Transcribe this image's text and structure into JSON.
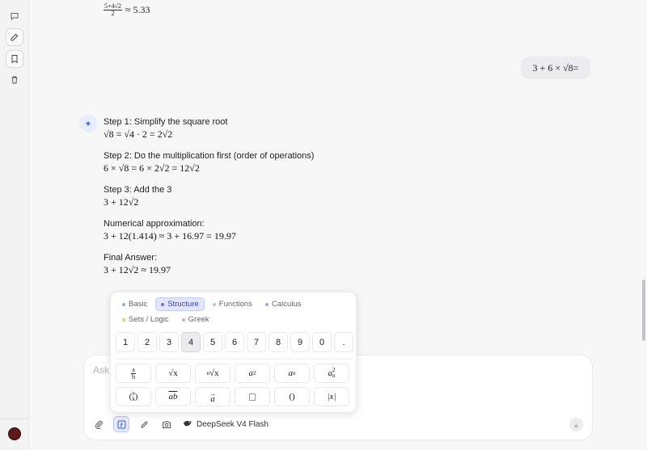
{
  "sidebar": {
    "icons": [
      "chat-icon",
      "edit-icon",
      "bookmark-icon",
      "trash-icon"
    ]
  },
  "conversation": {
    "previous_result": {
      "numerator": "5+4√2",
      "denominator": "2",
      "rest": "≈ 5.33"
    },
    "user_message": "3 + 6 × √8=",
    "steps": [
      {
        "label": "Step 1: Simplify the square root",
        "math": "√8 = √4 · 2 = 2√2"
      },
      {
        "label": "Step 2: Do the multiplication first (order of operations)",
        "math": "6 × √8 = 6 × 2√2 = 12√2"
      },
      {
        "label": "Step 3: Add the 3",
        "math": "3 + 12√2"
      },
      {
        "label": "Numerical approximation:",
        "math": "3 + 12(1.414) ≈ 3 + 16.97 = 19.97"
      },
      {
        "label": "Final Answer:",
        "math": "3 + 12√2 ≈ 19.97"
      }
    ]
  },
  "composer": {
    "placeholder": "Ask",
    "model": "DeepSeek V4 Flash"
  },
  "mathpad": {
    "tabs": [
      {
        "label": "Basic",
        "color": "#8fa8e8",
        "active": false
      },
      {
        "label": "Structure",
        "color": "#6b70d8",
        "active": true
      },
      {
        "label": "Functions",
        "color": "#9ccfd8",
        "active": false
      },
      {
        "label": "Calculus",
        "color": "#a9a0ec",
        "active": false
      },
      {
        "label": "Sets / Logic",
        "color": "#f0c27a",
        "active": false
      },
      {
        "label": "Greek",
        "color": "#f0a0b8",
        "active": false
      }
    ],
    "digits": [
      "1",
      "2",
      "3",
      "4",
      "5",
      "6",
      "7",
      "8",
      "9",
      "0",
      "."
    ],
    "pressed_digit": "4",
    "structure_keys": [
      "fraction",
      "sqrt",
      "nth-root",
      "superscript",
      "subscript",
      "sub-superscript",
      "binomial",
      "overline",
      "vector",
      "placeholder",
      "parentheses",
      "absolute-value"
    ],
    "key_text": {
      "frac_num": "a",
      "frac_den": "b",
      "sqrt": "√x",
      "nroot_idx": "n",
      "nroot": "√x",
      "sup_base": "a",
      "sup_exp": "2",
      "sub_base": "a",
      "sub_idx": "n",
      "subsup_base": "a",
      "subsup_exp": "2",
      "subsup_idx": "n",
      "binom_n": "n",
      "binom_k": "k",
      "overline": "ab",
      "vector": "a",
      "parens": "()",
      "abs": "|x|"
    }
  }
}
